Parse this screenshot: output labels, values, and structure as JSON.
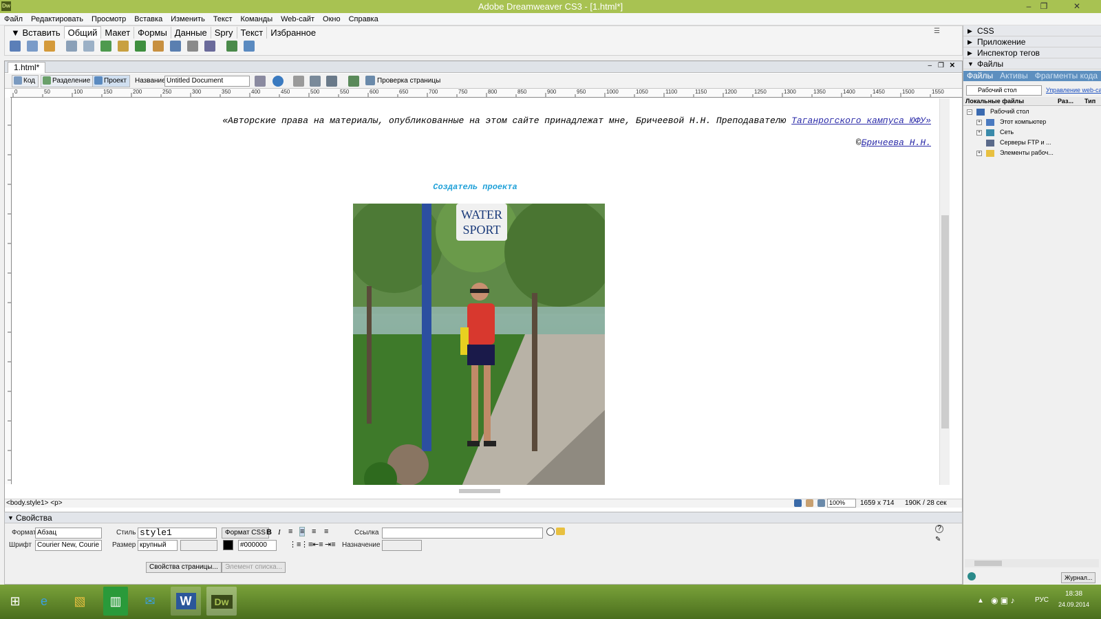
{
  "window": {
    "title": "Adobe Dreamweaver CS3 - [1.html*]",
    "app_icon": "Dw"
  },
  "menu": [
    "Файл",
    "Редактировать",
    "Просмотр",
    "Вставка",
    "Изменить",
    "Текст",
    "Команды",
    "Web-сайт",
    "Окно",
    "Справка"
  ],
  "insert_bar": {
    "label": "Вставить",
    "tabs": [
      "Общий",
      "Макет",
      "Формы",
      "Данные",
      "Spry",
      "Текст",
      "Избранное"
    ]
  },
  "document": {
    "tab": "1.html*",
    "toolbar": {
      "code": "Код",
      "split": "Разделение",
      "design": "Проект",
      "title_label": "Название:",
      "title_value": "Untitled Document",
      "check_page": "Проверка страницы"
    },
    "content": {
      "copyright_prefix": "«Авторские права на материалы, опубликованные на этом сайте принадлежат мне, Бричеевой Н.Н. Преподавателю ",
      "copyright_link": "Таганрогского кампуса ЮФУ»",
      "author_prefix": "©",
      "author_link": "Бричеева Н.Н.",
      "creator_heading": "Создатель проекта",
      "photo_sign_line1": "WATER",
      "photo_sign_line2": "SPORT"
    },
    "status": {
      "tag_path": "<body.style1> <p>",
      "zoom": "100%",
      "dimensions": "1659 x 714",
      "size": "190K / 28 сек"
    }
  },
  "properties": {
    "title": "Свойства",
    "format_label": "Формат",
    "format_value": "Абзац",
    "style_label": "Стиль",
    "style_value": "style1",
    "css_button": "Формат CSS",
    "link_label": "Ссылка",
    "link_value": "",
    "font_label": "Шрифт",
    "font_value": "Courier New, Courie",
    "size_label": "Размер",
    "size_value": "крупный",
    "color_value": "#000000",
    "target_label": "Назначение",
    "page_props_button": "Свойства страницы...",
    "list_item_button": "Элемент списка..."
  },
  "panels": {
    "css": "CSS",
    "app": "Приложение",
    "tag_inspector": "Инспектор тегов",
    "files": "Файлы",
    "files_tabs": [
      "Файлы",
      "Активы",
      "Фрагменты кода"
    ],
    "site_select": "Рабочий стол",
    "manage_link": "Управление web-сайтами",
    "columns": [
      "Локальные файлы",
      "Раз...",
      "Тип"
    ],
    "tree": [
      "Рабочий стол",
      "Этот компьютер",
      "Сеть",
      "Серверы FTP и ...",
      "Элементы рабоч..."
    ],
    "journal_button": "Журнал..."
  },
  "taskbar": {
    "lang": "РУС",
    "time": "18:38",
    "date": "24.09.2014"
  },
  "colors": {
    "title_bar": "#a8c252",
    "heading": "#1ea0d8",
    "link": "#2a2aa8",
    "files_tab": "#5d8fbf"
  }
}
